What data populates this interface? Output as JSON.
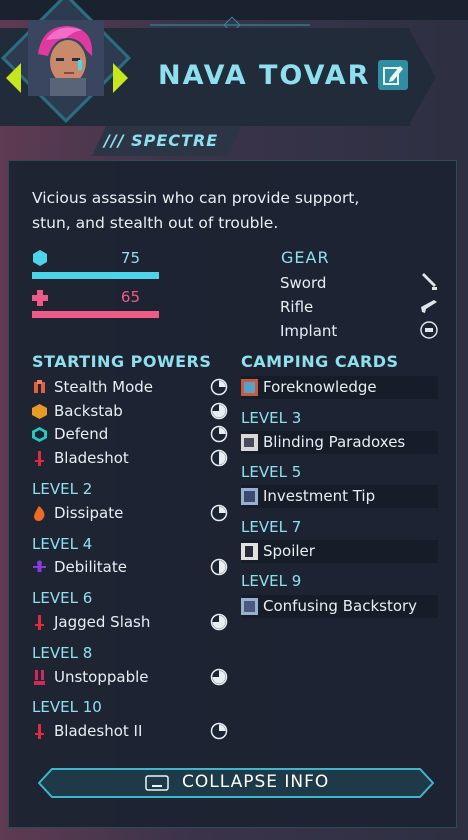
{
  "character": {
    "name": "NAVA TOVAR",
    "class": "/// SPECTRE",
    "description_line1": "Vicious assassin who can provide support,",
    "description_line2": "stun, and stealth out of trouble."
  },
  "stats": {
    "shield": {
      "value": "75",
      "color": "#4fd3e8"
    },
    "health": {
      "value": "65",
      "color": "#ee5b86"
    }
  },
  "gear": {
    "title": "GEAR",
    "items": [
      {
        "label": "Sword",
        "icon": "sword-icon"
      },
      {
        "label": "Rifle",
        "icon": "rifle-icon"
      },
      {
        "label": "Implant",
        "icon": "implant-icon"
      }
    ]
  },
  "starting_powers": {
    "title": "STARTING POWERS",
    "items": [
      {
        "label": "Stealth Mode",
        "icon": "stealth-icon",
        "cost_fill": 0.25
      },
      {
        "label": "Backstab",
        "icon": "backstab-icon",
        "cost_fill": 0.75
      },
      {
        "label": "Defend",
        "icon": "defend-icon",
        "cost_fill": 0.25
      },
      {
        "label": "Bladeshot",
        "icon": "bladeshot-icon",
        "cost_fill": 0.5
      }
    ]
  },
  "levels": [
    {
      "label": "LEVEL 2",
      "power": "Dissipate",
      "icon": "dissipate-icon",
      "cost_fill": 0.25
    },
    {
      "label": "LEVEL 4",
      "power": "Debilitate",
      "icon": "debilitate-icon",
      "cost_fill": 0.5
    },
    {
      "label": "LEVEL 6",
      "power": "Jagged Slash",
      "icon": "jagged-slash-icon",
      "cost_fill": 0.75
    },
    {
      "label": "LEVEL 8",
      "power": "Unstoppable",
      "icon": "unstoppable-icon",
      "cost_fill": 0.75
    },
    {
      "label": "LEVEL 10",
      "power": "Bladeshot II",
      "icon": "bladeshot-icon",
      "cost_fill": 0.25
    }
  ],
  "camping_cards": {
    "title": "CAMPING CARDS",
    "first": "Foreknowledge",
    "levels": [
      {
        "label": "LEVEL 3",
        "card": "Blinding Paradoxes"
      },
      {
        "label": "LEVEL 5",
        "card": "Investment Tip"
      },
      {
        "label": "LEVEL 7",
        "card": "Spoiler"
      },
      {
        "label": "LEVEL 9",
        "card": "Confusing Backstory"
      }
    ]
  },
  "collapse_button": {
    "label": "COLLAPSE INFO"
  },
  "colors": {
    "accent": "#8fe0ef",
    "arrow": "#c8e61e",
    "panel": "#1c2331"
  }
}
